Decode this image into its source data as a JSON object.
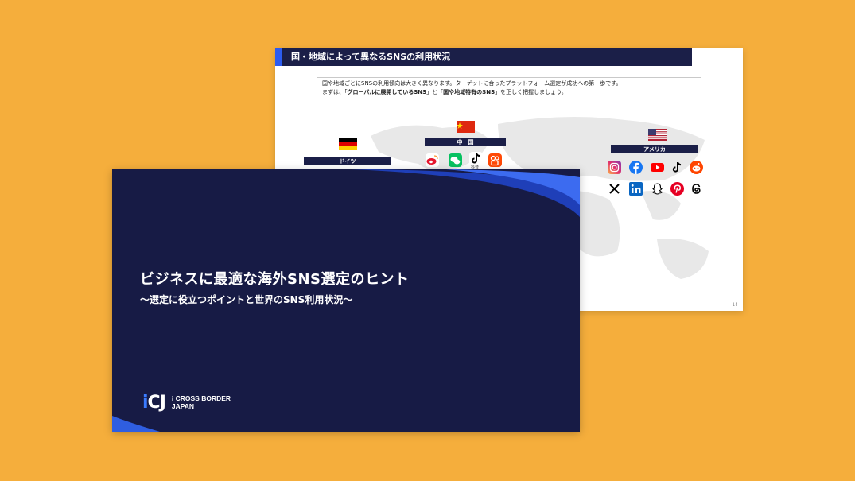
{
  "back_slide": {
    "header": "国・地域によって異なるSNSの利用状況",
    "intro_line1": "国や地域ごとにSNSの利用傾向は大きく異なります。ターゲットに合ったプラットフォーム選定が成功への第一歩です。",
    "intro_line2_prefix": "まずは、「",
    "intro_link1": "グローバルに展開しているSNS",
    "intro_mid": "」と「",
    "intro_link2": "国や地域特有のSNS",
    "intro_suffix": "」を正しく把握しましょう。",
    "countries": {
      "germany": "ドイツ",
      "china": "中　国",
      "usa": "アメリカ"
    },
    "douyin_label": "抖音",
    "page_number": "14",
    "icons": [
      "weibo-icon",
      "wechat-icon",
      "douyin-icon",
      "kuaishou-icon",
      "instagram-icon",
      "facebook-icon",
      "youtube-icon",
      "tiktok-icon",
      "reddit-icon",
      "x-icon",
      "linkedin-icon",
      "snapchat-icon",
      "pinterest-icon",
      "threads-icon"
    ]
  },
  "front_slide": {
    "title": "ビジネスに最適な海外SNS選定のヒント",
    "subtitle": "〜選定に役立つポイントと世界のSNS利用状況〜",
    "logo_mark_i": "i",
    "logo_mark_rest": "CJ",
    "logo_line1": "i CROSS BORDER",
    "logo_line2": "JAPAN"
  },
  "colors": {
    "background": "#F5AE3C",
    "navy": "#171B45",
    "accent_blue": "#2C5CF0"
  }
}
